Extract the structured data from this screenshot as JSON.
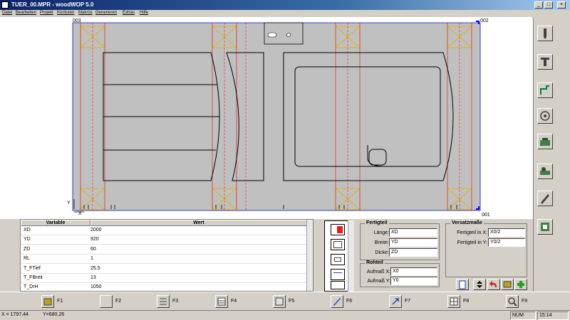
{
  "window": {
    "title": "TUER_00.MPR - woodWOP 5.0",
    "minimize": "_",
    "maximize": "□",
    "close": "×"
  },
  "menu": [
    "Datei",
    "Bearbeiten",
    "Projekt",
    "Konturen",
    "Makros",
    "Generieren",
    "Extras",
    "Hilfe"
  ],
  "canvas": {
    "corner_tl": "003",
    "corner_tr": "002",
    "corner_br": "001",
    "axis_y": "Y",
    "axis_x": "X"
  },
  "variables": {
    "header_name": "Variable",
    "header_value": "Wert",
    "rows": [
      {
        "name": "XD",
        "value": "2000"
      },
      {
        "name": "YD",
        "value": "920"
      },
      {
        "name": "ZD",
        "value": "60"
      },
      {
        "name": "RL",
        "value": "1"
      },
      {
        "name": "T_FTief",
        "value": "25.5"
      },
      {
        "name": "T_FBreit",
        "value": "13"
      },
      {
        "name": "T_DrH",
        "value": "1050"
      }
    ]
  },
  "fertigteil": {
    "title": "Fertigteil",
    "laenge_label": "Länge:",
    "laenge_value": "XD",
    "breite_label": "Breite:",
    "breite_value": "YD",
    "dicke_label": "Dicke:",
    "dicke_value": "ZD"
  },
  "rohteil": {
    "title": "Rohteil",
    "aufmass_x_label": "Aufmaß X:",
    "aufmass_x_value": "X0",
    "aufmass_y_label": "Aufmaß Y:",
    "aufmass_y_value": "Y0"
  },
  "versatzmasse": {
    "title": "Versatzmaße",
    "x_label": "Fertigteil in X:",
    "x_value": "X0/2",
    "y_label": "Fertigteil in Y:",
    "y_value": "Y0/2"
  },
  "fkeys": [
    {
      "label": "F1",
      "icon": "book-icon"
    },
    {
      "label": "F2",
      "icon": "blank-icon"
    },
    {
      "label": "F3",
      "icon": "list-icon"
    },
    {
      "label": "F4",
      "icon": "table-icon"
    },
    {
      "label": "F5",
      "icon": "layers-icon"
    },
    {
      "label": "F6",
      "icon": "pen-icon"
    },
    {
      "label": "F7",
      "icon": "arrow-icon"
    },
    {
      "label": "F8",
      "icon": "grid-icon"
    },
    {
      "label": "F9",
      "icon": "zoom-icon"
    }
  ],
  "status": {
    "x_readout": "X = 1797.44",
    "y_readout": "Y=680.26",
    "num": "NUM",
    "time": "15:14"
  }
}
